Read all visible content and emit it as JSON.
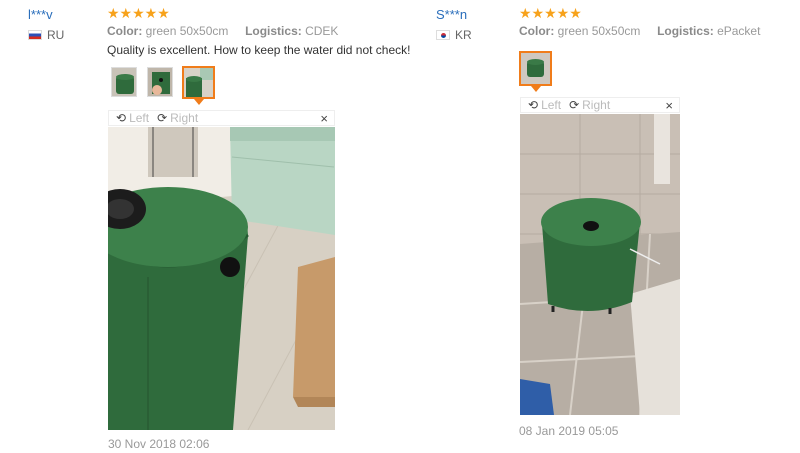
{
  "reviews": [
    {
      "user": "l***v",
      "country": "RU",
      "rating_stars": "★★★★★",
      "color_label": "Color:",
      "color_value": "green 50x50cm",
      "logistics_label": "Logistics:",
      "logistics_value": "CDEK",
      "text": "Quality is excellent. How to keep the water did not check!",
      "viewer": {
        "left": "Left",
        "right": "Right",
        "close": "×"
      },
      "date": "30 Nov 2018 02:06"
    },
    {
      "user": "S***n",
      "country": "KR",
      "rating_stars": "★★★★★",
      "color_label": "Color:",
      "color_value": "green 50x50cm",
      "logistics_label": "Logistics:",
      "logistics_value": "ePacket",
      "viewer": {
        "left": "Left",
        "right": "Right",
        "close": "×"
      },
      "date": "08 Jan 2019 05:05"
    }
  ],
  "colors": {
    "accent": "#f07c1a",
    "star": "#f7a21b",
    "link": "#2a6ebb",
    "barrel": "#2f6b3c"
  }
}
